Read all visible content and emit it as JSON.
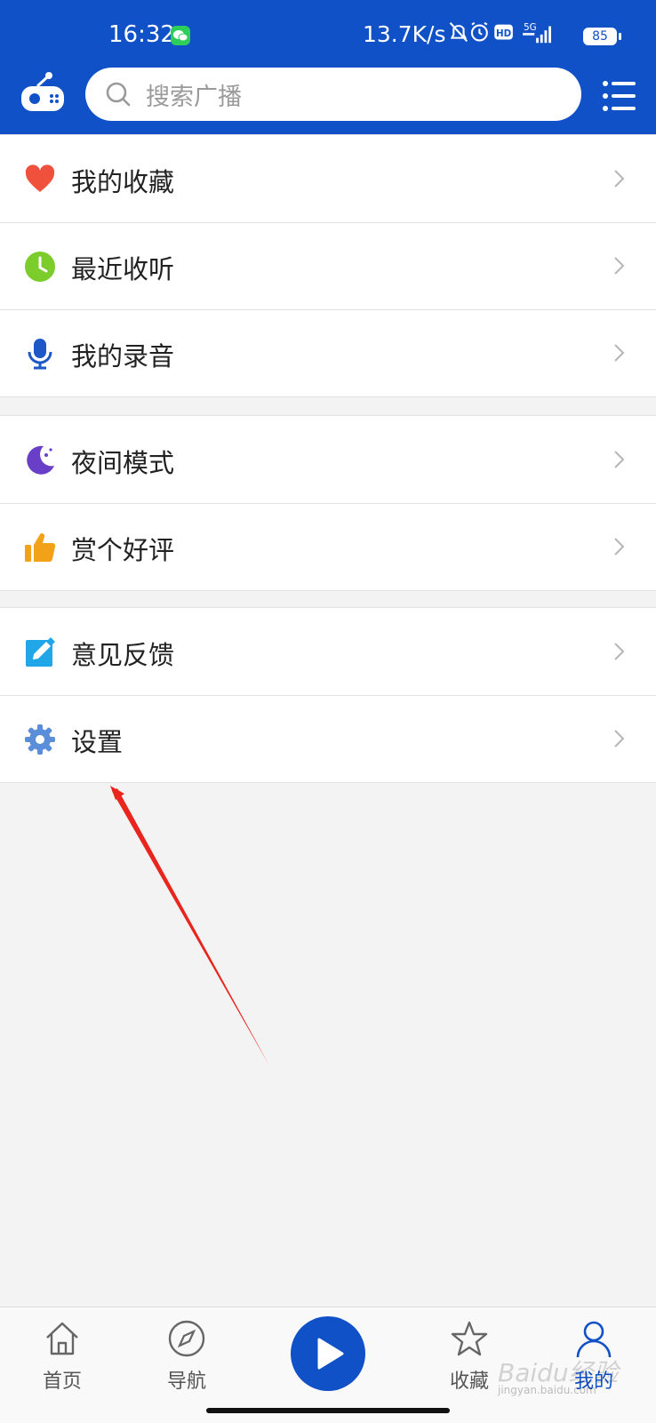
{
  "status_bar": {
    "time": "16:32",
    "network_speed": "13.7K/s",
    "battery_level": "85",
    "signal_label": "5G",
    "hd_label": "HD",
    "icons": [
      "wechat-icon",
      "mute-bell-icon",
      "alarm-icon",
      "hd-icon",
      "signal-icon",
      "battery-icon"
    ]
  },
  "header": {
    "logo_icon": "radio-icon",
    "search_placeholder": "搜索广播",
    "menu_icon": "list-menu-icon"
  },
  "sections": [
    {
      "items": [
        {
          "label": "我的收藏",
          "icon": "heart-icon",
          "icon_color": "#f0513c"
        },
        {
          "label": "最近收听",
          "icon": "clock-icon",
          "icon_color": "#7ccc2c"
        },
        {
          "label": "我的录音",
          "icon": "microphone-icon",
          "icon_color": "#1e57c6"
        }
      ]
    },
    {
      "items": [
        {
          "label": "夜间模式",
          "icon": "moon-icon",
          "icon_color": "#6a3fc8"
        },
        {
          "label": "赏个好评",
          "icon": "thumbs-up-icon",
          "icon_color": "#f2a218"
        }
      ]
    },
    {
      "items": [
        {
          "label": "意见反馈",
          "icon": "edit-icon",
          "icon_color": "#21a6e8"
        },
        {
          "label": "设置",
          "icon": "gear-icon",
          "icon_color": "#5a8ed8"
        }
      ]
    }
  ],
  "bottom_nav": {
    "tabs": [
      {
        "label": "首页",
        "icon": "home-icon"
      },
      {
        "label": "导航",
        "icon": "compass-icon"
      },
      {
        "label": "收藏",
        "icon": "star-icon"
      },
      {
        "label": "我的",
        "icon": "person-icon",
        "active": true
      }
    ],
    "play_icon": "play-icon",
    "watermark": "Baidu经验",
    "watermark_sub": "jingyan.baidu.com"
  },
  "colors": {
    "brand_blue": "#1151c8",
    "page_bg": "#f3f3f3",
    "annotation_arrow": "#e8261e"
  }
}
